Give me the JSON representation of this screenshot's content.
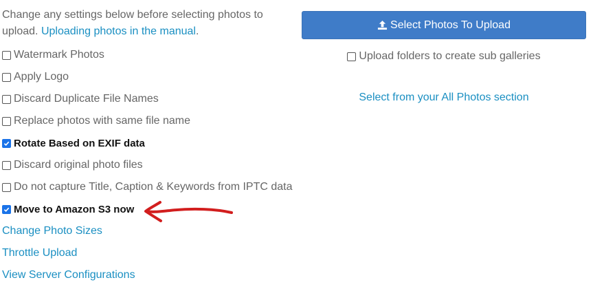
{
  "intro": {
    "text": "Change any settings below before selecting photos to upload. ",
    "manual_link": "Uploading photos in the manual",
    "trailing": "."
  },
  "options": [
    {
      "label": "Watermark Photos",
      "checked": false
    },
    {
      "label": "Apply Logo",
      "checked": false
    },
    {
      "label": "Discard Duplicate File Names",
      "checked": false
    },
    {
      "label": "Replace photos with same file name",
      "checked": false
    },
    {
      "label": "Rotate Based on EXIF data",
      "checked": true
    },
    {
      "label": "Discard original photo files",
      "checked": false
    },
    {
      "label": "Do not capture Title, Caption & Keywords from IPTC data",
      "checked": false
    },
    {
      "label": "Move to Amazon S3 now",
      "checked": true
    }
  ],
  "links": {
    "change_sizes": "Change Photo Sizes",
    "throttle": "Throttle Upload",
    "server_config": "View Server Configurations"
  },
  "right": {
    "upload_button": "Select Photos To Upload",
    "upload_icon": "upload-icon",
    "subgalleries_label": "Upload folders to create sub galleries",
    "subgalleries_checked": false,
    "all_photos_link": "Select from your All Photos section"
  },
  "colors": {
    "link": "#1a8fc2",
    "button": "#3f7cc8",
    "annotation_arrow": "#d21e1e"
  }
}
